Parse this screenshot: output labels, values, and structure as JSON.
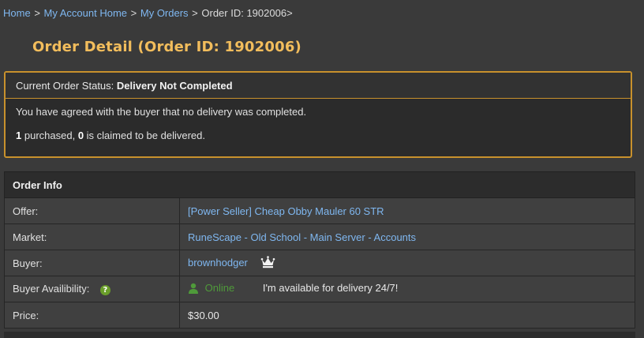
{
  "breadcrumb": {
    "home": "Home",
    "account": "My Account Home",
    "orders": "My Orders",
    "current": "Order ID: 1902006>",
    "separator": ">"
  },
  "page_title": "Order Detail (Order ID: 1902006)",
  "status": {
    "label": "Current Order Status:",
    "value": "Delivery Not Completed",
    "message": "You have agreed with the buyer that no delivery was completed.",
    "purchased_count": "1",
    "purchased_text": "purchased,",
    "claimed_count": "0",
    "claimed_text": "is claimed to be delivered."
  },
  "order_info": {
    "header": "Order Info",
    "offer_label": "Offer:",
    "offer_value": "[Power Seller] Cheap Obby Mauler 60 STR",
    "market_label": "Market:",
    "market_value": "RuneScape - Old School - Main Server - Accounts",
    "buyer_label": "Buyer:",
    "buyer_value": "brownhodger",
    "availability_label": "Buyer Availibility:",
    "availability_status": "Online",
    "availability_note": "I'm available for delivery 24/7!",
    "price_label": "Price:",
    "price_value": "$30.00"
  },
  "icons": {
    "help": "question-icon",
    "crown": "crown-icon",
    "online": "user-online-icon"
  },
  "colors": {
    "background": "#3a3a3a",
    "title": "#f2bd5c",
    "link": "#7fb7f0",
    "status_border": "#c8912c",
    "online": "#4f9a3a"
  }
}
